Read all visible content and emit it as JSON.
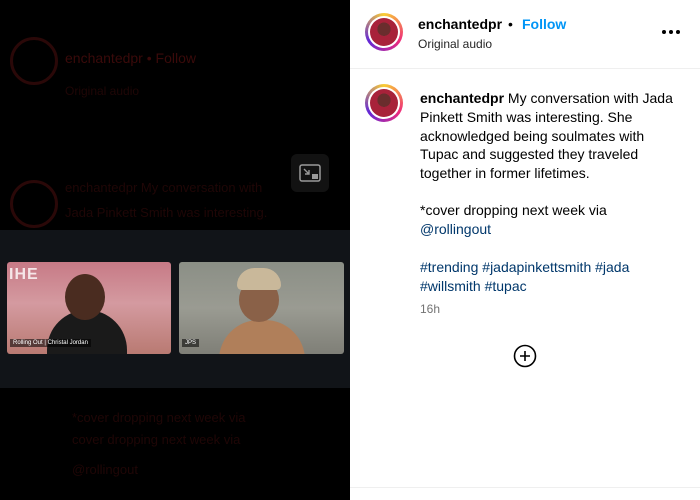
{
  "post": {
    "username": "enchantedpr",
    "separator": "•",
    "follow_label": "Follow",
    "audio_label": "Original audio",
    "caption_line1": "My conversation with Jada Pinkett Smith was interesting. She acknowledged being soulmates with Tupac and suggested they traveled together in former lifetimes.",
    "caption_line2": "*cover dropping next week via",
    "mention": "@rollingout",
    "hashtags": [
      "#trending",
      "#jadapinkettsmith",
      "#jada",
      "#willsmith",
      "#tupac"
    ],
    "timestamp": "16h"
  },
  "video": {
    "left_caption": "Rolling Out | Christal Jordan",
    "right_caption": "JPS"
  },
  "icons": {
    "more": "more-options-icon",
    "pip": "picture-in-picture-icon",
    "add": "add-comment-icon"
  },
  "colors": {
    "follow": "#0095f6",
    "link": "#00376b",
    "muted": "#737373"
  }
}
